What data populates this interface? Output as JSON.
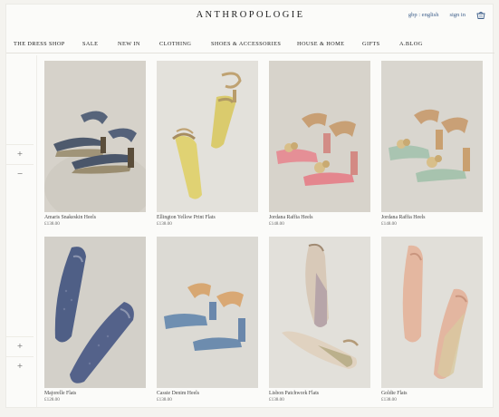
{
  "header": {
    "logo": "ANTHROPOLOGIE",
    "locale": "gbp : english",
    "signin": "sign in",
    "basket_icon": "basket-icon"
  },
  "nav": {
    "items": [
      "THE DRESS SHOP",
      "SALE",
      "NEW IN",
      "CLOTHING",
      "SHOES & ACCESSORIES",
      "HOUSE & HOME",
      "GIFTS",
      "A.BLOG"
    ]
  },
  "side": {
    "buttons": [
      "+",
      "−",
      "+",
      "+"
    ]
  },
  "products": [
    {
      "name": "Amaris Snakeskin Heels",
      "price": "£138.00"
    },
    {
      "name": "Ellington Yellow Print Flats",
      "price": "£138.00"
    },
    {
      "name": "Jordana Raffia Heels",
      "price": "£148.00"
    },
    {
      "name": "Jordana Raffia Heels",
      "price": "£148.00"
    },
    {
      "name": "Majorelle Flats",
      "price": "£128.00"
    },
    {
      "name": "Cassie Denim Heels",
      "price": "£138.00"
    },
    {
      "name": "Lisbon Patchwork Flats",
      "price": "£138.00"
    },
    {
      "name": "Goldie Flats",
      "price": "£138.00"
    }
  ],
  "colors": {
    "link": "#3d5e8a",
    "background": "#fbfbf9"
  }
}
